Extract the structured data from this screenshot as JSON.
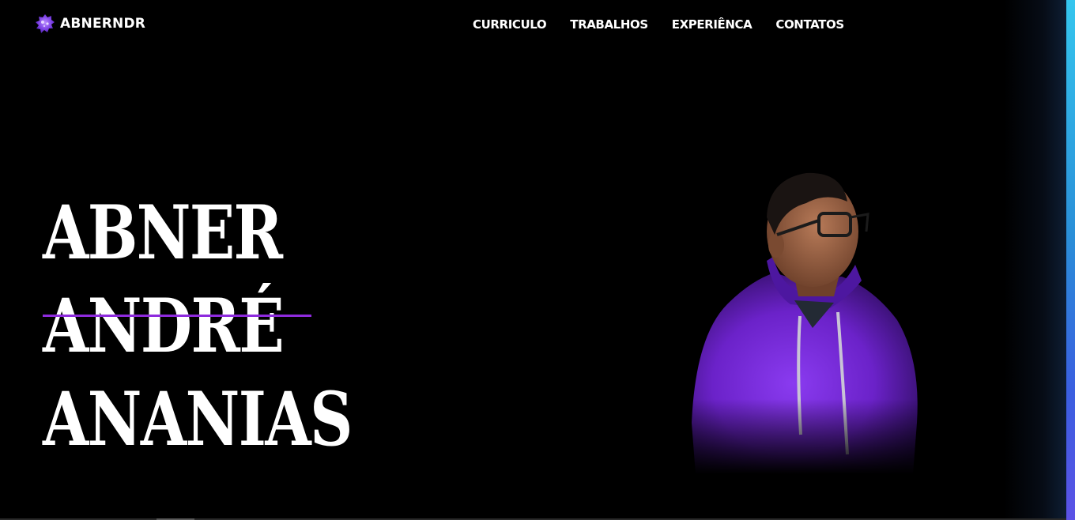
{
  "logo": {
    "text": "ABNERNDR",
    "icon": "purple-blob-logo-icon"
  },
  "nav": {
    "items": [
      {
        "label": "CURRICULO"
      },
      {
        "label": "TRABALHOS"
      },
      {
        "label": "EXPERIÊNCA"
      },
      {
        "label": "CONTATOS"
      }
    ]
  },
  "hero": {
    "name_lines": [
      "ABNER",
      "ANDRÉ",
      "ANANIAS"
    ],
    "photo": "portrait-photo",
    "accent_color": "#8e2bdd"
  },
  "colors": {
    "background": "#000000",
    "text": "#ffffff",
    "accent": "#8e2bdd",
    "edge_gradient_top": "#35c6ee",
    "edge_gradient_bottom": "#5c52e6"
  }
}
